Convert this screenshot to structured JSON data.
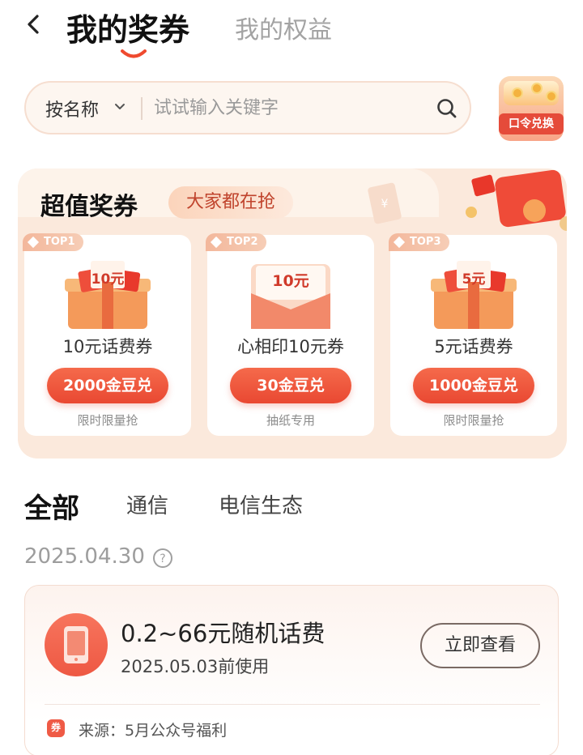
{
  "header": {
    "back_icon": "chevron-left-icon",
    "tab_active": "我的奖券",
    "tab_inactive": "我的权益"
  },
  "search": {
    "category": "按名称",
    "placeholder": "试试输入关键字",
    "value": ""
  },
  "code_button": {
    "label": "口令兑换"
  },
  "super": {
    "title": "超值奖券",
    "pill": "大家都在抢",
    "cards": [
      {
        "rank": "TOP1",
        "badge": "10元",
        "name": "10元话费券",
        "button": "2000金豆兑",
        "sub": "限时限量抢"
      },
      {
        "rank": "TOP2",
        "badge": "10元",
        "name": "心相印10元券",
        "button": "30金豆兑",
        "sub": "抽纸专用"
      },
      {
        "rank": "TOP3",
        "badge": "5元",
        "name": "5元话费券",
        "button": "1000金豆兑",
        "sub": "限时限量抢"
      }
    ]
  },
  "categories": [
    "全部",
    "通信",
    "电信生态"
  ],
  "list": {
    "date": "2025.04.30",
    "voucher": {
      "title": "0.2~66元随机话费",
      "expire": "2025.05.03前使用",
      "button": "立即查看",
      "source": "来源：5月公众号福利",
      "source_icon_text": "券"
    }
  },
  "colors": {
    "accent": "#e94832",
    "accent_light": "#fbe9dc",
    "text_muted": "#9d9d9d"
  }
}
